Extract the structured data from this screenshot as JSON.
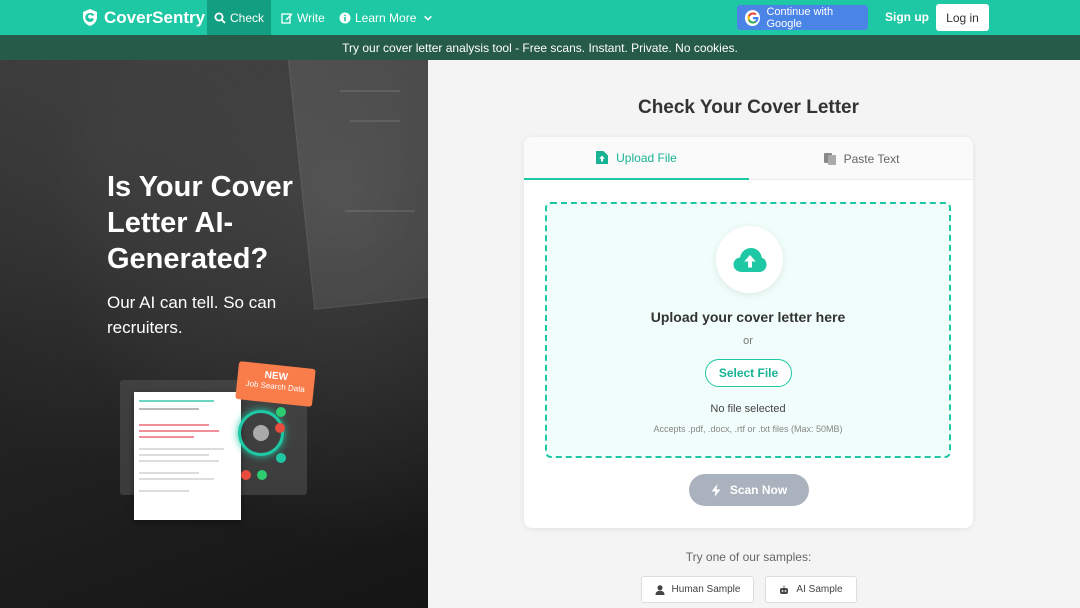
{
  "nav": {
    "brand": "CoverSentry",
    "items": [
      {
        "label": "Check",
        "icon": "search-icon"
      },
      {
        "label": "Write",
        "icon": "edit-icon"
      },
      {
        "label": "Learn More",
        "icon": "info-icon"
      }
    ],
    "google_label": "Continue with Google",
    "signup": "Sign up",
    "login": "Log in"
  },
  "banner": {
    "icon": "",
    "text": "Try our cover letter analysis tool - Free scans. Instant. Private. No cookies."
  },
  "hero": {
    "title": "Is Your Cover Letter AI-Generated?",
    "subtitle": "Our AI can tell. So can recruiters.",
    "badge_title": "NEW",
    "badge_sub": "Job Search Data"
  },
  "checker": {
    "title": "Check Your Cover Letter",
    "tabs": [
      {
        "label": "Upload File",
        "active": true
      },
      {
        "label": "Paste Text",
        "active": false
      }
    ],
    "upload_title": "Upload your cover letter here",
    "or": "or",
    "select_file": "Select File",
    "no_file": "No file selected",
    "accepts": "Accepts .pdf, .docx, .rtf or .txt files (Max: 50MB)",
    "scan_now": "Scan Now"
  },
  "samples": {
    "label": "Try one of our samples:",
    "human": "Human Sample",
    "ai": "AI Sample"
  },
  "colors": {
    "accent": "#1ec8a5",
    "nav_active": "#129e81",
    "banner": "#265a49",
    "google": "#4b84e7",
    "scan_disabled": "#a9b2bd",
    "badge": "#f97c4b"
  }
}
